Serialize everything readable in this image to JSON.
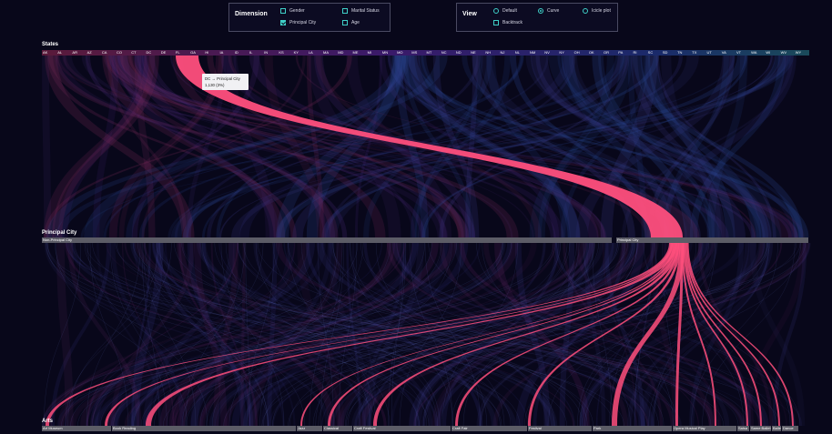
{
  "controls": {
    "dimension": {
      "title": "Dimension",
      "options": [
        {
          "label": "Gender",
          "checked": false
        },
        {
          "label": "Marital Status",
          "checked": false
        },
        {
          "label": "Principal City",
          "checked": true
        },
        {
          "label": "Age",
          "checked": false
        }
      ]
    },
    "view": {
      "title": "View",
      "options": [
        {
          "label": "Default",
          "checked": false
        },
        {
          "label": "Curve",
          "checked": true
        },
        {
          "label": "Icicle plot",
          "checked": false
        },
        {
          "label": "Backtrack",
          "checked": false
        }
      ]
    }
  },
  "dimensions": {
    "states": {
      "title": "States",
      "labels": [
        "AK",
        "AL",
        "AR",
        "AZ",
        "CA",
        "CO",
        "CT",
        "DC",
        "DE",
        "FL",
        "GA",
        "HI",
        "IA",
        "ID",
        "IL",
        "IN",
        "KS",
        "KY",
        "LA",
        "MA",
        "MD",
        "ME",
        "MI",
        "MN",
        "MO",
        "MS",
        "MT",
        "NC",
        "ND",
        "NE",
        "NH",
        "NJ",
        "NL",
        "NM",
        "NV",
        "NY",
        "OH",
        "OK",
        "OR",
        "PA",
        "RI",
        "SC",
        "SD",
        "TN",
        "TX",
        "UT",
        "VA",
        "VT",
        "WA",
        "WI",
        "WV",
        "WY"
      ]
    },
    "principal_city": {
      "title": "Principal City",
      "categories": [
        "Non-Principal City",
        "Principal City"
      ]
    },
    "arts": {
      "title": "Arts",
      "categories": [
        "Art Museum",
        "Book Reading",
        "Jazz",
        "Classical",
        "Craft Festival",
        "Craft Fair",
        "Festival",
        "Park",
        "Opera Musical Play",
        "Salsa",
        "Same Ballet",
        "Ballet",
        "Dance"
      ]
    }
  },
  "tooltip": {
    "title": "DC → Principal City",
    "value": "1,130 (3%)"
  },
  "colors": {
    "background": "#08071a",
    "highlight": "#ff4f7d",
    "accent": "#3fd0c8"
  }
}
